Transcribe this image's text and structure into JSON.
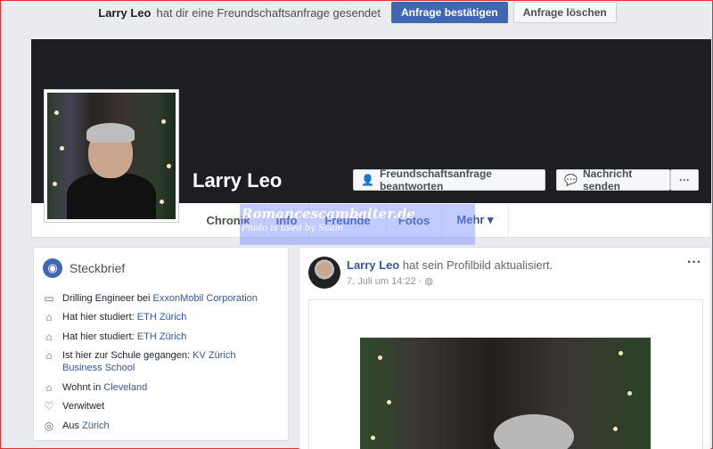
{
  "request_bar": {
    "name": "Larry Leo",
    "text": "hat dir eine Freundschaftsanfrage gesendet",
    "confirm_label": "Anfrage bestätigen",
    "delete_label": "Anfrage löschen"
  },
  "profile": {
    "name": "Larry Leo",
    "respond_label": "Freundschaftsanfrage beantworten",
    "message_label": "Nachricht senden",
    "more_label": "···"
  },
  "tabs": [
    {
      "label": "Chronik"
    },
    {
      "label": "Info"
    },
    {
      "label": "Freunde"
    },
    {
      "label": "Fotos"
    },
    {
      "label": "Mehr ▾"
    }
  ],
  "watermark": {
    "line1": "Romancescambaiter.de",
    "line2": "Photo is used by Scam"
  },
  "intro": {
    "title": "Steckbrief",
    "items": [
      {
        "icon": "briefcase-icon",
        "text": "Drilling Engineer bei ",
        "link": "ExxonMobil Corporation"
      },
      {
        "icon": "graduation-cap-icon",
        "text": "Hat hier studiert: ",
        "link": "ETH Zürich"
      },
      {
        "icon": "graduation-cap-icon",
        "text": "Hat hier studiert: ",
        "link": "ETH Zürich"
      },
      {
        "icon": "graduation-cap-icon",
        "text": "Ist hier zur Schule gegangen: ",
        "link": "KV Zürich Business School"
      },
      {
        "icon": "home-icon",
        "text": "Wohnt in ",
        "link": "Cleveland"
      },
      {
        "icon": "heart-icon",
        "text": "Verwitwet",
        "link": ""
      },
      {
        "icon": "location-pin-icon",
        "text": "Aus ",
        "link": "Zürich"
      }
    ]
  },
  "post": {
    "author": "Larry Leo",
    "action": "hat sein Profilbild aktualisiert.",
    "time": "7. Juli um 14:22 · ",
    "dots": "···"
  }
}
